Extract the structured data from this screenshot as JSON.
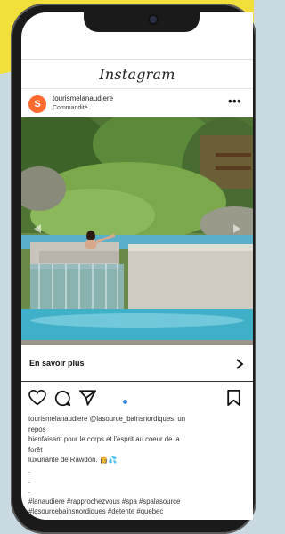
{
  "app": {
    "title": "Instagram"
  },
  "post": {
    "account": "tourismelanaudiere",
    "sponsored_label": "Commandité",
    "avatar_letter": "S",
    "cta_label": "En savoir plus",
    "caption_lines": [
      "tourismelanaudiere @lasource_bainsnordiques, un",
      "repos",
      "bienfaisant pour le corps et l'esprit au coeur de la",
      "forêt",
      "luxuriante de Rawdon. 👸💦",
      ".",
      ".",
      ".",
      "#lanaudiere #rapprochezvous #spa #spalasource",
      "#lasourcebainsnordiques #detente #quebec"
    ]
  },
  "colors": {
    "accent": "#ff6a2f",
    "carousel_dot": "#3c8ee8",
    "page_yellow": "#f2e03a",
    "page_blue": "#c8d9e2"
  },
  "icons": [
    "more-dots-icon",
    "chevron-right-icon",
    "heart-icon",
    "comment-icon",
    "share-icon",
    "bookmark-icon",
    "carousel-dot"
  ]
}
